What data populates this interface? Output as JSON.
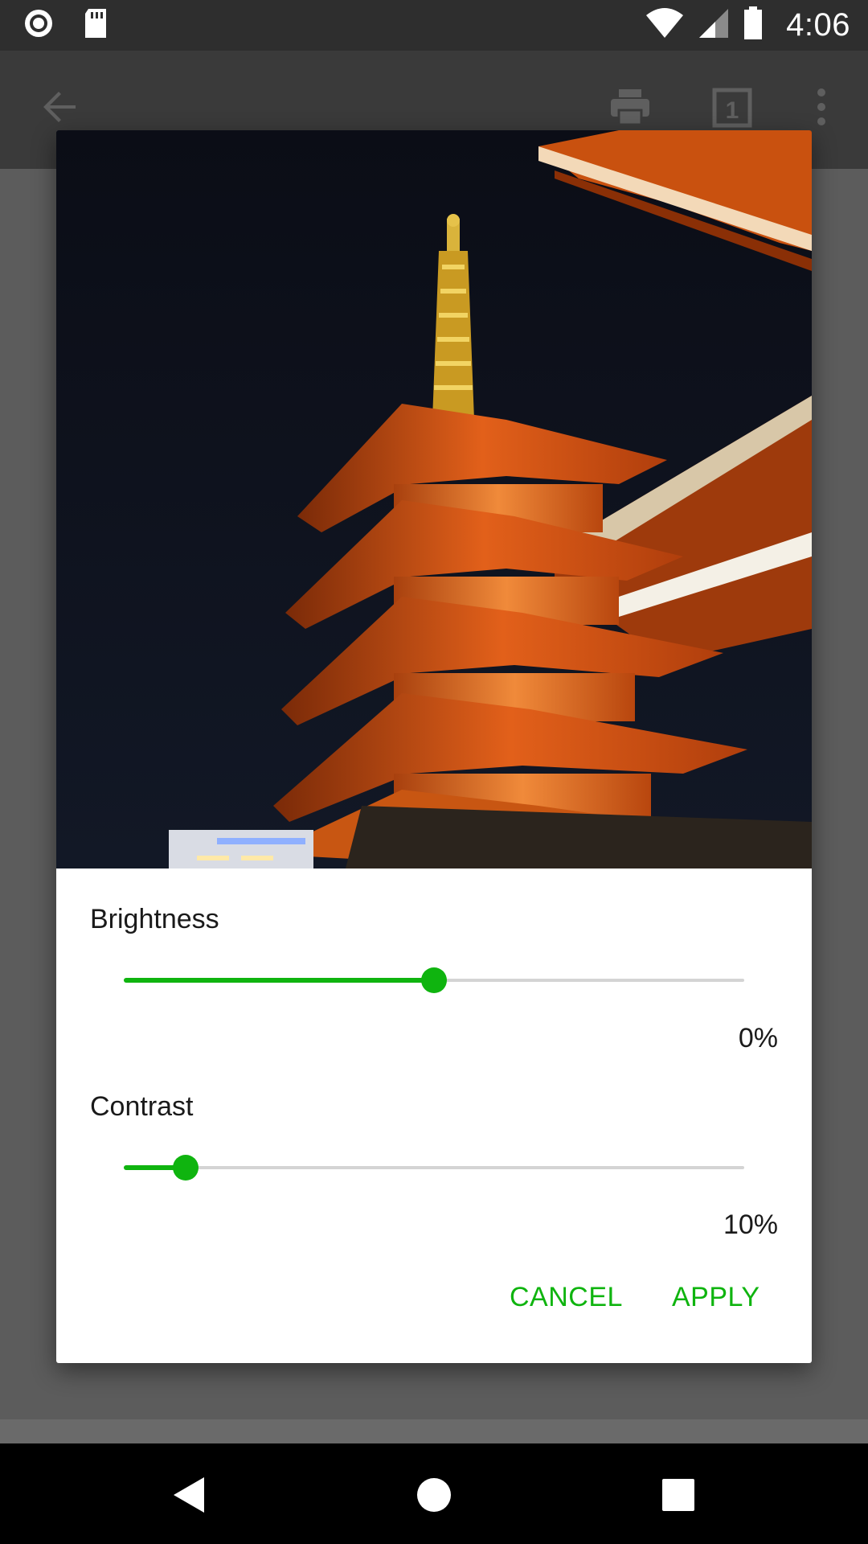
{
  "status_bar": {
    "time": "4:06",
    "icons": [
      "record-icon",
      "sd-card-icon",
      "wifi-icon",
      "cell-signal-icon",
      "battery-icon"
    ]
  },
  "app_bar": {
    "icons": [
      "back-arrow-icon",
      "print-icon",
      "page-count-icon",
      "overflow-menu-icon"
    ],
    "page_count": "1"
  },
  "dialog": {
    "preview_image": "pagoda-at-night-photo",
    "brightness": {
      "label": "Brightness",
      "value_text": "0%",
      "position": 0.5
    },
    "contrast": {
      "label": "Contrast",
      "value_text": "10%",
      "position": 0.1
    },
    "cancel_label": "CANCEL",
    "apply_label": "APPLY"
  },
  "nav_bar": {
    "icons": [
      "back-nav-icon",
      "home-nav-icon",
      "recents-nav-icon"
    ]
  },
  "colors": {
    "accent": "#0fb40f",
    "status_bar": "#2e2e2e",
    "scrim": "#5c5c5c"
  }
}
